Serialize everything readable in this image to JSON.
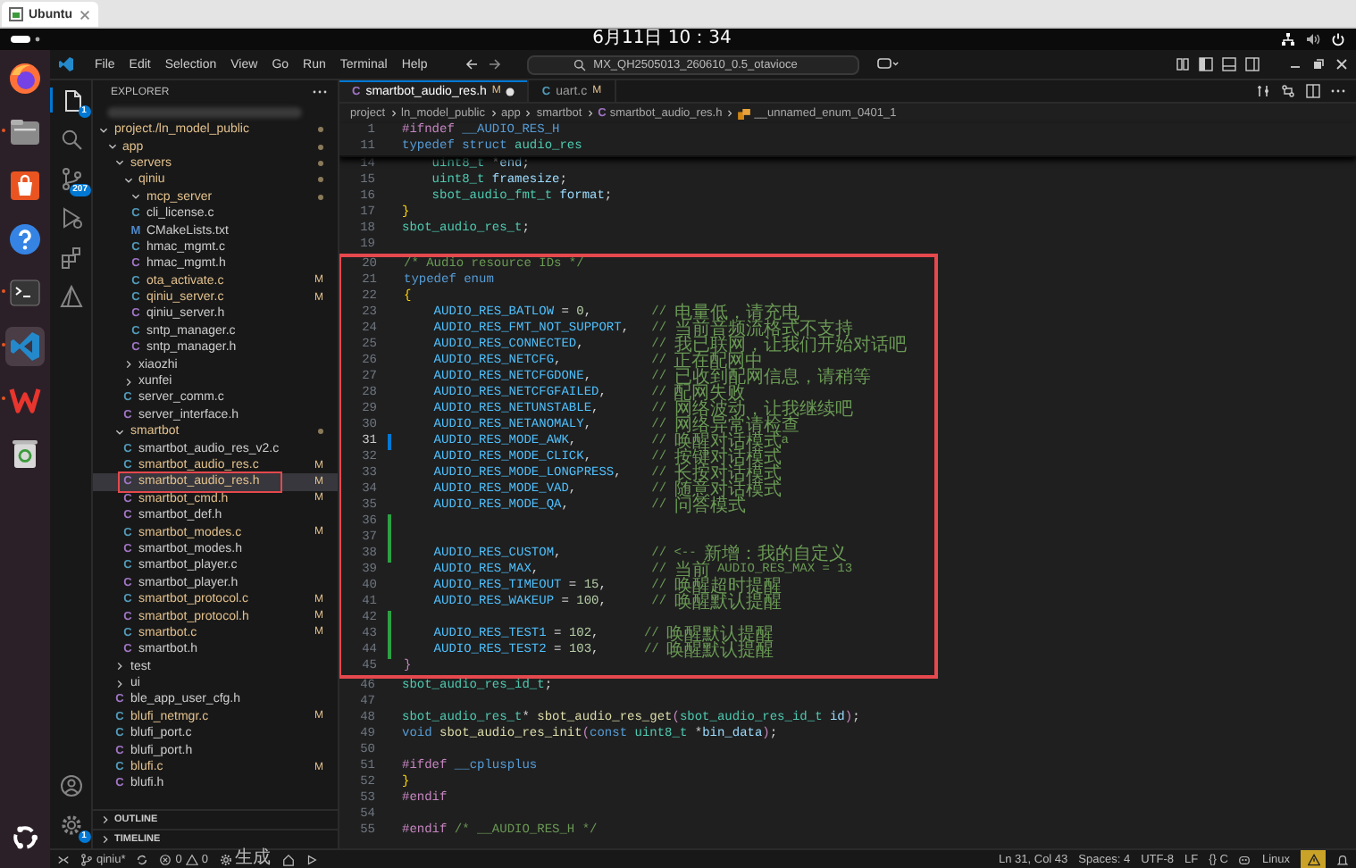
{
  "browser": {
    "tabs": [
      {
        "title": "Ubuntu",
        "selected": true
      }
    ]
  },
  "top_bar": {
    "clock": "6月11日 10：34"
  },
  "dock": {
    "items": [
      {
        "kind": "firefox",
        "running": false,
        "active": false
      },
      {
        "kind": "files",
        "running": true,
        "active": false
      },
      {
        "kind": "app-center",
        "running": false,
        "active": false
      },
      {
        "kind": "help",
        "running": false,
        "active": false
      },
      {
        "kind": "terminal",
        "running": true,
        "active": false
      },
      {
        "kind": "vscode",
        "running": true,
        "active": true
      },
      {
        "kind": "wps",
        "running": true,
        "active": false
      },
      {
        "kind": "trash",
        "running": false,
        "active": false
      }
    ]
  },
  "title_bar": {
    "menu": [
      "File",
      "Edit",
      "Selection",
      "View",
      "Go",
      "Run",
      "Terminal",
      "Help"
    ],
    "search": {
      "value": "MX_QH2505013_260610_0.5_otavioce"
    }
  },
  "activity_bar": {
    "items": [
      {
        "kind": "explorer",
        "selected": true,
        "badge": "1"
      },
      {
        "kind": "search",
        "selected": false
      },
      {
        "kind": "source-control",
        "selected": false,
        "badge": "207"
      },
      {
        "kind": "run-debug",
        "selected": false
      },
      {
        "kind": "extensions",
        "selected": false
      },
      {
        "kind": "cmake",
        "selected": false
      }
    ],
    "bottom": [
      {
        "kind": "account"
      },
      {
        "kind": "settings",
        "badge": "1"
      }
    ]
  },
  "explorer": {
    "title": "EXPLORER",
    "tree": [
      {
        "name": "project./ln_model_public",
        "kind": "folder",
        "expanded": true,
        "modified": true,
        "selected": false,
        "children": [
          {
            "name": "app",
            "kind": "folder",
            "expanded": true,
            "modified": true,
            "selected": false,
            "children": [
              {
                "name": "servers",
                "kind": "folder",
                "expanded": true,
                "modified": true,
                "selected": false,
                "children": [
                  {
                    "name": "qiniu",
                    "kind": "folder",
                    "expanded": true,
                    "modified": true,
                    "selected": false,
                    "children": [
                      {
                        "name": "mcp_server",
                        "kind": "folder",
                        "expanded": true,
                        "modified": true,
                        "selected": false
                      },
                      {
                        "name": "cli_license.c",
                        "kind": "c",
                        "icon": "C",
                        "modified": false,
                        "selected": false
                      },
                      {
                        "name": "CMakeLists.txt",
                        "kind": "cmake",
                        "icon": "M",
                        "modified": false,
                        "selected": false
                      },
                      {
                        "name": "hmac_mgmt.c",
                        "kind": "c",
                        "icon": "C",
                        "modified": false,
                        "selected": false
                      },
                      {
                        "name": "hmac_mgmt.h",
                        "kind": "h",
                        "icon": "C",
                        "modified": false,
                        "selected": false
                      },
                      {
                        "name": "ota_activate.c",
                        "kind": "c",
                        "icon": "C",
                        "modified": true,
                        "status": "M",
                        "selected": false
                      },
                      {
                        "name": "qiniu_server.c",
                        "kind": "c",
                        "icon": "C",
                        "modified": true,
                        "status": "M",
                        "selected": false
                      },
                      {
                        "name": "qiniu_server.h",
                        "kind": "h",
                        "icon": "C",
                        "modified": false,
                        "selected": false
                      },
                      {
                        "name": "sntp_manager.c",
                        "kind": "c",
                        "icon": "C",
                        "modified": false,
                        "selected": false
                      },
                      {
                        "name": "sntp_manager.h",
                        "kind": "h",
                        "icon": "C",
                        "modified": false,
                        "selected": false
                      }
                    ]
                  },
                  {
                    "name": "xiaozhi",
                    "kind": "folder",
                    "expanded": false,
                    "modified": false,
                    "selected": false
                  },
                  {
                    "name": "xunfei",
                    "kind": "folder",
                    "expanded": false,
                    "modified": false,
                    "selected": false
                  },
                  {
                    "name": "server_comm.c",
                    "kind": "c",
                    "icon": "C",
                    "modified": false,
                    "selected": false
                  },
                  {
                    "name": "server_interface.h",
                    "kind": "h",
                    "icon": "C",
                    "modified": false,
                    "selected": false
                  }
                ]
              },
              {
                "name": "smartbot",
                "kind": "folder",
                "expanded": true,
                "modified": true,
                "selected": false,
                "children": [
                  {
                    "name": "smartbot_audio_res_v2.c",
                    "kind": "c",
                    "icon": "C",
                    "modified": false,
                    "selected": false
                  },
                  {
                    "name": "smartbot_audio_res.c",
                    "kind": "c",
                    "icon": "C",
                    "modified": true,
                    "status": "M",
                    "selected": false
                  },
                  {
                    "name": "smartbot_audio_res.h",
                    "kind": "h",
                    "icon": "C",
                    "modified": true,
                    "status": "M",
                    "selected": true,
                    "annotated": true
                  },
                  {
                    "name": "smartbot_cmd.h",
                    "kind": "h",
                    "icon": "C",
                    "modified": true,
                    "status": "M",
                    "selected": false
                  },
                  {
                    "name": "smartbot_def.h",
                    "kind": "h",
                    "icon": "C",
                    "modified": false,
                    "selected": false
                  },
                  {
                    "name": "smartbot_modes.c",
                    "kind": "c",
                    "icon": "C",
                    "modified": true,
                    "status": "M",
                    "selected": false
                  },
                  {
                    "name": "smartbot_modes.h",
                    "kind": "h",
                    "icon": "C",
                    "modified": false,
                    "selected": false
                  },
                  {
                    "name": "smartbot_player.c",
                    "kind": "c",
                    "icon": "C",
                    "modified": false,
                    "selected": false
                  },
                  {
                    "name": "smartbot_player.h",
                    "kind": "h",
                    "icon": "C",
                    "modified": false,
                    "selected": false
                  },
                  {
                    "name": "smartbot_protocol.c",
                    "kind": "c",
                    "icon": "C",
                    "modified": true,
                    "status": "M",
                    "selected": false
                  },
                  {
                    "name": "smartbot_protocol.h",
                    "kind": "h",
                    "icon": "C",
                    "modified": true,
                    "status": "M",
                    "selected": false
                  },
                  {
                    "name": "smartbot.c",
                    "kind": "c",
                    "icon": "C",
                    "modified": true,
                    "status": "M",
                    "selected": false
                  },
                  {
                    "name": "smartbot.h",
                    "kind": "h",
                    "icon": "C",
                    "modified": false,
                    "selected": false
                  }
                ]
              },
              {
                "name": "test",
                "kind": "folder",
                "expanded": false,
                "modified": false,
                "selected": false
              },
              {
                "name": "ui",
                "kind": "folder",
                "expanded": false,
                "modified": false,
                "selected": false
              },
              {
                "name": "ble_app_user_cfg.h",
                "kind": "h",
                "icon": "C",
                "modified": false,
                "selected": false
              },
              {
                "name": "blufi_netmgr.c",
                "kind": "c",
                "icon": "C",
                "modified": true,
                "status": "M",
                "selected": false
              },
              {
                "name": "blufi_port.c",
                "kind": "c",
                "icon": "C",
                "modified": false,
                "selected": false
              },
              {
                "name": "blufi_port.h",
                "kind": "h",
                "icon": "C",
                "modified": false,
                "selected": false
              },
              {
                "name": "blufi.c",
                "kind": "c",
                "icon": "C",
                "modified": true,
                "status": "M",
                "selected": false
              },
              {
                "name": "blufi.h",
                "kind": "h",
                "icon": "C",
                "modified": false,
                "selected": false
              }
            ]
          }
        ]
      }
    ],
    "sections": [
      {
        "title": "OUTLINE",
        "expanded": false
      },
      {
        "title": "TIMELINE",
        "expanded": false
      }
    ]
  },
  "editor": {
    "tabs": [
      {
        "label": "smartbot_audio_res.h",
        "icon": "C",
        "kind": "h",
        "status": "M",
        "dirty": true,
        "selected": true
      },
      {
        "label": "uart.c",
        "icon": "C",
        "kind": "c",
        "status": "M",
        "dirty": false,
        "selected": false
      }
    ],
    "breadcrumb": [
      {
        "text": "project",
        "kind": "folder"
      },
      {
        "text": "ln_model_public",
        "kind": "folder"
      },
      {
        "text": "app",
        "kind": "folder"
      },
      {
        "text": "smartbot",
        "kind": "folder"
      },
      {
        "text": "smartbot_audio_res.h",
        "kind": "file",
        "icon": "C"
      },
      {
        "text": "__unnamed_enum_0401_1",
        "kind": "symbol"
      }
    ],
    "sticky_lines": [
      {
        "number": "1",
        "tokens": [
          {
            "kind": "preproc",
            "text": "#ifndef"
          },
          {
            "kind": "macro",
            "text": " __AUDIO_RES_H"
          }
        ]
      },
      {
        "number": "11",
        "tokens": [
          {
            "kind": "keyword",
            "text": "typedef struct"
          },
          {
            "kind": "type",
            "text": " audio_res"
          }
        ]
      }
    ],
    "blocks": [
      {
        "boxed": false,
        "lines": [
          {
            "number": "14",
            "tokens": [
              {
                "kind": "type",
                "text": "    uint8_t"
              },
              {
                "kind": "plain",
                "text": " *"
              },
              {
                "kind": "variable",
                "text": "end"
              },
              {
                "kind": "plain",
                "text": ";"
              }
            ]
          },
          {
            "number": "15",
            "tokens": [
              {
                "kind": "type",
                "text": "    uint8_t"
              },
              {
                "kind": "variable",
                "text": " framesize"
              },
              {
                "kind": "plain",
                "text": ";"
              }
            ]
          },
          {
            "number": "16",
            "tokens": [
              {
                "kind": "type",
                "text": "    sbot_audio_fmt_t"
              },
              {
                "kind": "variable",
                "text": " format"
              },
              {
                "kind": "plain",
                "text": ";"
              }
            ]
          },
          {
            "number": "17",
            "tokens": [
              {
                "kind": "bracket",
                "text": "}"
              }
            ]
          },
          {
            "number": "18",
            "tokens": [
              {
                "kind": "type",
                "text": "sbot_audio_res_t"
              },
              {
                "kind": "plain",
                "text": ";"
              }
            ]
          },
          {
            "number": "19"
          }
        ]
      },
      {
        "boxed": true,
        "lines": [
          {
            "number": "20",
            "tokens": [
              {
                "kind": "comment",
                "text": "/* Audio resource IDs */"
              }
            ]
          },
          {
            "number": "21",
            "tokens": [
              {
                "kind": "keyword",
                "text": "typedef enum"
              }
            ]
          },
          {
            "number": "22",
            "tokens": [
              {
                "kind": "bracket",
                "text": "{"
              }
            ]
          },
          {
            "number": "23",
            "tokens": [
              {
                "kind": "enum",
                "text": "    AUDIO_RES_BATLOW"
              },
              {
                "kind": "plain",
                "text": " = "
              },
              {
                "kind": "number",
                "text": "0"
              },
              {
                "kind": "plain",
                "text": ",        "
              },
              {
                "kind": "comment",
                "text": "// 电量低，请充电"
              }
            ]
          },
          {
            "number": "24",
            "tokens": [
              {
                "kind": "enum",
                "text": "    AUDIO_RES_FMT_NOT_SUPPORT"
              },
              {
                "kind": "plain",
                "text": ",   "
              },
              {
                "kind": "comment",
                "text": "// 当前音频流格式不支持"
              }
            ]
          },
          {
            "number": "25",
            "tokens": [
              {
                "kind": "enum",
                "text": "    AUDIO_RES_CONNECTED"
              },
              {
                "kind": "plain",
                "text": ",         "
              },
              {
                "kind": "comment",
                "text": "// 我已联网，让我们开始对话吧"
              }
            ]
          },
          {
            "number": "26",
            "tokens": [
              {
                "kind": "enum",
                "text": "    AUDIO_RES_NETCFG"
              },
              {
                "kind": "plain",
                "text": ",            "
              },
              {
                "kind": "comment",
                "text": "// 正在配网中"
              }
            ]
          },
          {
            "number": "27",
            "tokens": [
              {
                "kind": "enum",
                "text": "    AUDIO_RES_NETCFGDONE"
              },
              {
                "kind": "plain",
                "text": ",        "
              },
              {
                "kind": "comment",
                "text": "// 已收到配网信息，请稍等"
              }
            ]
          },
          {
            "number": "28",
            "tokens": [
              {
                "kind": "enum",
                "text": "    AUDIO_RES_NETCFGFAILED"
              },
              {
                "kind": "plain",
                "text": ",      "
              },
              {
                "kind": "comment",
                "text": "// 配网失败"
              }
            ]
          },
          {
            "number": "29",
            "tokens": [
              {
                "kind": "enum",
                "text": "    AUDIO_RES_NETUNSTABLE"
              },
              {
                "kind": "plain",
                "text": ",       "
              },
              {
                "kind": "comment",
                "text": "// 网络波动，让我继续吧"
              }
            ]
          },
          {
            "number": "30",
            "tokens": [
              {
                "kind": "enum",
                "text": "    AUDIO_RES_NETANOMALY"
              },
              {
                "kind": "plain",
                "text": ",        "
              },
              {
                "kind": "comment",
                "text": "// 网络异常请检查"
              }
            ]
          },
          {
            "number": "31",
            "modified": true,
            "current": true,
            "tokens": [
              {
                "kind": "enum",
                "text": "    AUDIO_RES_MODE_AWK"
              },
              {
                "kind": "plain",
                "text": ",          "
              },
              {
                "kind": "comment",
                "text": "// 唤醒对话模式a"
              }
            ]
          },
          {
            "number": "32",
            "tokens": [
              {
                "kind": "enum",
                "text": "    AUDIO_RES_MODE_CLICK"
              },
              {
                "kind": "plain",
                "text": ",        "
              },
              {
                "kind": "comment",
                "text": "// 按键对话模式"
              }
            ]
          },
          {
            "number": "33",
            "tokens": [
              {
                "kind": "enum",
                "text": "    AUDIO_RES_MODE_LONGPRESS"
              },
              {
                "kind": "plain",
                "text": ",    "
              },
              {
                "kind": "comment",
                "text": "// 长按对话模式"
              }
            ]
          },
          {
            "number": "34",
            "tokens": [
              {
                "kind": "enum",
                "text": "    AUDIO_RES_MODE_VAD"
              },
              {
                "kind": "plain",
                "text": ",          "
              },
              {
                "kind": "comment",
                "text": "// 随意对话模式"
              }
            ]
          },
          {
            "number": "35",
            "tokens": [
              {
                "kind": "enum",
                "text": "    AUDIO_RES_MODE_QA"
              },
              {
                "kind": "plain",
                "text": ",           "
              },
              {
                "kind": "comment",
                "text": "// 问答模式"
              }
            ]
          },
          {
            "number": "36",
            "added": true
          },
          {
            "number": "37",
            "added": true
          },
          {
            "number": "38",
            "added": true,
            "tokens": [
              {
                "kind": "enum",
                "text": "    AUDIO_RES_CUSTOM"
              },
              {
                "kind": "plain",
                "text": ",            "
              },
              {
                "kind": "comment",
                "text": "// <-- 新增：我的自定义"
              }
            ]
          },
          {
            "number": "39",
            "tokens": [
              {
                "kind": "enum",
                "text": "    AUDIO_RES_MAX"
              },
              {
                "kind": "plain",
                "text": ",               "
              },
              {
                "kind": "comment",
                "text": "// 当前 AUDIO_RES_MAX = 13"
              }
            ]
          },
          {
            "number": "40",
            "tokens": [
              {
                "kind": "enum",
                "text": "    AUDIO_RES_TIMEOUT"
              },
              {
                "kind": "plain",
                "text": " = "
              },
              {
                "kind": "number",
                "text": "15"
              },
              {
                "kind": "plain",
                "text": ",      "
              },
              {
                "kind": "comment",
                "text": "// 唤醒超时提醒"
              }
            ]
          },
          {
            "number": "41",
            "tokens": [
              {
                "kind": "enum",
                "text": "    AUDIO_RES_WAKEUP"
              },
              {
                "kind": "plain",
                "text": " = "
              },
              {
                "kind": "number",
                "text": "100"
              },
              {
                "kind": "plain",
                "text": ",      "
              },
              {
                "kind": "comment",
                "text": "// 唤醒默认提醒"
              }
            ]
          },
          {
            "number": "42",
            "added": true
          },
          {
            "number": "43",
            "added": true,
            "tokens": [
              {
                "kind": "enum",
                "text": "    AUDIO_RES_TEST1"
              },
              {
                "kind": "plain",
                "text": " = "
              },
              {
                "kind": "number",
                "text": "102"
              },
              {
                "kind": "plain",
                "text": ",      "
              },
              {
                "kind": "comment",
                "text": "// 唤醒默认提醒"
              }
            ]
          },
          {
            "number": "44",
            "added": true,
            "tokens": [
              {
                "kind": "enum",
                "text": "    AUDIO_RES_TEST2"
              },
              {
                "kind": "plain",
                "text": " = "
              },
              {
                "kind": "number",
                "text": "103"
              },
              {
                "kind": "plain",
                "text": ",      "
              },
              {
                "kind": "comment",
                "text": "// 唤醒默认提醒"
              }
            ]
          },
          {
            "number": "45",
            "tokens": [
              {
                "kind": "preproc",
                "text": "}"
              }
            ]
          }
        ]
      },
      {
        "boxed": false,
        "lines": [
          {
            "number": "46",
            "tokens": [
              {
                "kind": "type",
                "text": "sbot_audio_res_id_t"
              },
              {
                "kind": "plain",
                "text": ";"
              }
            ]
          },
          {
            "number": "47"
          },
          {
            "number": "48",
            "tokens": [
              {
                "kind": "type",
                "text": "sbot_audio_res_t"
              },
              {
                "kind": "plain",
                "text": "* "
              },
              {
                "kind": "function",
                "text": "sbot_audio_res_get"
              },
              {
                "kind": "preproc",
                "text": "("
              },
              {
                "kind": "type",
                "text": "sbot_audio_res_id_t"
              },
              {
                "kind": "variable",
                "text": " id"
              },
              {
                "kind": "preproc",
                "text": ")"
              },
              {
                "kind": "plain",
                "text": ";"
              }
            ]
          },
          {
            "number": "49",
            "tokens": [
              {
                "kind": "keyword",
                "text": "void"
              },
              {
                "kind": "function",
                "text": " sbot_audio_res_init"
              },
              {
                "kind": "preproc",
                "text": "("
              },
              {
                "kind": "keyword",
                "text": "const"
              },
              {
                "kind": "type",
                "text": " uint8_t"
              },
              {
                "kind": "plain",
                "text": " *"
              },
              {
                "kind": "variable",
                "text": "bin_data"
              },
              {
                "kind": "preproc",
                "text": ")"
              },
              {
                "kind": "plain",
                "text": ";"
              }
            ]
          },
          {
            "number": "50"
          },
          {
            "number": "51",
            "tokens": [
              {
                "kind": "preproc",
                "text": "#ifdef"
              },
              {
                "kind": "macro",
                "text": " __cplusplus"
              }
            ]
          },
          {
            "number": "52",
            "tokens": [
              {
                "kind": "bracket",
                "text": "}"
              }
            ]
          },
          {
            "number": "53",
            "tokens": [
              {
                "kind": "preproc",
                "text": "#endif"
              }
            ]
          },
          {
            "number": "54"
          },
          {
            "number": "55",
            "tokens": [
              {
                "kind": "preproc",
                "text": "#endif"
              },
              {
                "kind": "comment",
                "text": " /* __AUDIO_RES_H */"
              }
            ]
          }
        ]
      }
    ]
  },
  "status_bar": {
    "branch": "qiniu*",
    "errors": "0",
    "warnings": "0",
    "task": "生成",
    "position": "Ln 31, Col 43",
    "indent": "Spaces: 4",
    "encoding": "UTF-8",
    "eol": "LF",
    "language": "{} C",
    "platform": "Linux"
  }
}
